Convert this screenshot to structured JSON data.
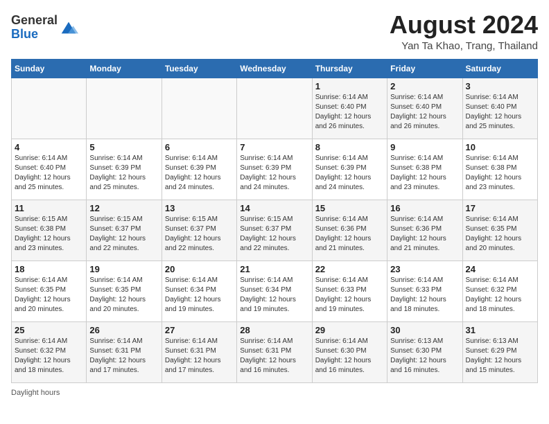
{
  "header": {
    "logo_general": "General",
    "logo_blue": "Blue",
    "month_year": "August 2024",
    "location": "Yan Ta Khao, Trang, Thailand"
  },
  "calendar": {
    "weekdays": [
      "Sunday",
      "Monday",
      "Tuesday",
      "Wednesday",
      "Thursday",
      "Friday",
      "Saturday"
    ],
    "weeks": [
      [
        {
          "day": "",
          "info": ""
        },
        {
          "day": "",
          "info": ""
        },
        {
          "day": "",
          "info": ""
        },
        {
          "day": "",
          "info": ""
        },
        {
          "day": "1",
          "info": "Sunrise: 6:14 AM\nSunset: 6:40 PM\nDaylight: 12 hours and 26 minutes."
        },
        {
          "day": "2",
          "info": "Sunrise: 6:14 AM\nSunset: 6:40 PM\nDaylight: 12 hours and 26 minutes."
        },
        {
          "day": "3",
          "info": "Sunrise: 6:14 AM\nSunset: 6:40 PM\nDaylight: 12 hours and 25 minutes."
        }
      ],
      [
        {
          "day": "4",
          "info": "Sunrise: 6:14 AM\nSunset: 6:40 PM\nDaylight: 12 hours and 25 minutes."
        },
        {
          "day": "5",
          "info": "Sunrise: 6:14 AM\nSunset: 6:39 PM\nDaylight: 12 hours and 25 minutes."
        },
        {
          "day": "6",
          "info": "Sunrise: 6:14 AM\nSunset: 6:39 PM\nDaylight: 12 hours and 24 minutes."
        },
        {
          "day": "7",
          "info": "Sunrise: 6:14 AM\nSunset: 6:39 PM\nDaylight: 12 hours and 24 minutes."
        },
        {
          "day": "8",
          "info": "Sunrise: 6:14 AM\nSunset: 6:39 PM\nDaylight: 12 hours and 24 minutes."
        },
        {
          "day": "9",
          "info": "Sunrise: 6:14 AM\nSunset: 6:38 PM\nDaylight: 12 hours and 23 minutes."
        },
        {
          "day": "10",
          "info": "Sunrise: 6:14 AM\nSunset: 6:38 PM\nDaylight: 12 hours and 23 minutes."
        }
      ],
      [
        {
          "day": "11",
          "info": "Sunrise: 6:15 AM\nSunset: 6:38 PM\nDaylight: 12 hours and 23 minutes."
        },
        {
          "day": "12",
          "info": "Sunrise: 6:15 AM\nSunset: 6:37 PM\nDaylight: 12 hours and 22 minutes."
        },
        {
          "day": "13",
          "info": "Sunrise: 6:15 AM\nSunset: 6:37 PM\nDaylight: 12 hours and 22 minutes."
        },
        {
          "day": "14",
          "info": "Sunrise: 6:15 AM\nSunset: 6:37 PM\nDaylight: 12 hours and 22 minutes."
        },
        {
          "day": "15",
          "info": "Sunrise: 6:14 AM\nSunset: 6:36 PM\nDaylight: 12 hours and 21 minutes."
        },
        {
          "day": "16",
          "info": "Sunrise: 6:14 AM\nSunset: 6:36 PM\nDaylight: 12 hours and 21 minutes."
        },
        {
          "day": "17",
          "info": "Sunrise: 6:14 AM\nSunset: 6:35 PM\nDaylight: 12 hours and 20 minutes."
        }
      ],
      [
        {
          "day": "18",
          "info": "Sunrise: 6:14 AM\nSunset: 6:35 PM\nDaylight: 12 hours and 20 minutes."
        },
        {
          "day": "19",
          "info": "Sunrise: 6:14 AM\nSunset: 6:35 PM\nDaylight: 12 hours and 20 minutes."
        },
        {
          "day": "20",
          "info": "Sunrise: 6:14 AM\nSunset: 6:34 PM\nDaylight: 12 hours and 19 minutes."
        },
        {
          "day": "21",
          "info": "Sunrise: 6:14 AM\nSunset: 6:34 PM\nDaylight: 12 hours and 19 minutes."
        },
        {
          "day": "22",
          "info": "Sunrise: 6:14 AM\nSunset: 6:33 PM\nDaylight: 12 hours and 19 minutes."
        },
        {
          "day": "23",
          "info": "Sunrise: 6:14 AM\nSunset: 6:33 PM\nDaylight: 12 hours and 18 minutes."
        },
        {
          "day": "24",
          "info": "Sunrise: 6:14 AM\nSunset: 6:32 PM\nDaylight: 12 hours and 18 minutes."
        }
      ],
      [
        {
          "day": "25",
          "info": "Sunrise: 6:14 AM\nSunset: 6:32 PM\nDaylight: 12 hours and 18 minutes."
        },
        {
          "day": "26",
          "info": "Sunrise: 6:14 AM\nSunset: 6:31 PM\nDaylight: 12 hours and 17 minutes."
        },
        {
          "day": "27",
          "info": "Sunrise: 6:14 AM\nSunset: 6:31 PM\nDaylight: 12 hours and 17 minutes."
        },
        {
          "day": "28",
          "info": "Sunrise: 6:14 AM\nSunset: 6:31 PM\nDaylight: 12 hours and 16 minutes."
        },
        {
          "day": "29",
          "info": "Sunrise: 6:14 AM\nSunset: 6:30 PM\nDaylight: 12 hours and 16 minutes."
        },
        {
          "day": "30",
          "info": "Sunrise: 6:13 AM\nSunset: 6:30 PM\nDaylight: 12 hours and 16 minutes."
        },
        {
          "day": "31",
          "info": "Sunrise: 6:13 AM\nSunset: 6:29 PM\nDaylight: 12 hours and 15 minutes."
        }
      ]
    ]
  },
  "footer": {
    "note": "Daylight hours"
  }
}
